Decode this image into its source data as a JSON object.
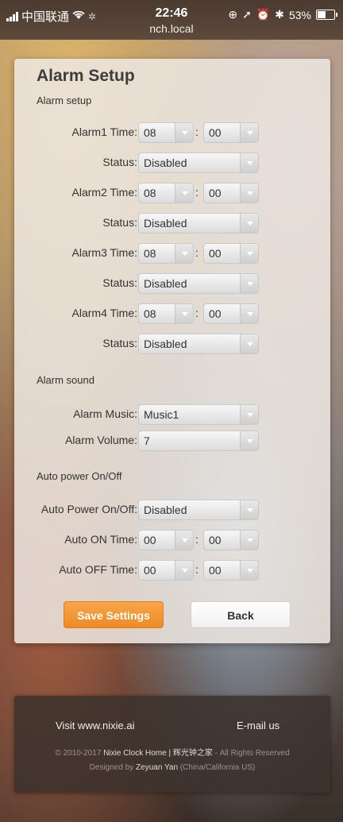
{
  "status_bar": {
    "carrier": "中国联通",
    "time": "22:46",
    "url": "nch.local",
    "battery_percent": 53,
    "battery_label": "53%"
  },
  "page": {
    "title": "Alarm Setup",
    "sections": {
      "alarm_setup": "Alarm setup",
      "alarm_sound": "Alarm sound",
      "auto_power": "Auto power On/Off"
    },
    "alarms": [
      {
        "time_label": "Alarm1 Time:",
        "hour": "08",
        "minute": "00",
        "status_label": "Status:",
        "status": "Disabled"
      },
      {
        "time_label": "Alarm2 Time:",
        "hour": "08",
        "minute": "00",
        "status_label": "Status:",
        "status": "Disabled"
      },
      {
        "time_label": "Alarm3 Time:",
        "hour": "08",
        "minute": "00",
        "status_label": "Status:",
        "status": "Disabled"
      },
      {
        "time_label": "Alarm4 Time:",
        "hour": "08",
        "minute": "00",
        "status_label": "Status:",
        "status": "Disabled"
      }
    ],
    "sound": {
      "music_label": "Alarm Music:",
      "music": "Music1",
      "volume_label": "Alarm Volume:",
      "volume": "7"
    },
    "auto_power": {
      "mode_label": "Auto Power On/Off:",
      "mode": "Disabled",
      "on_label": "Auto ON Time:",
      "on_hour": "00",
      "on_minute": "00",
      "off_label": "Auto OFF Time:",
      "off_hour": "00",
      "off_minute": "00"
    },
    "colon": ":",
    "buttons": {
      "save": "Save Settings",
      "back": "Back"
    }
  },
  "footer": {
    "visit": "Visit www.nixie.ai",
    "email": "E-mail us",
    "copyright_prefix": "© 2010-2017 ",
    "copyright_site": "Nixie Clock Home | 辉光钟之家",
    "copyright_suffix": " - All Rights Reserved",
    "designed_prefix": "Designed by ",
    "designer": "Zeyuan Yan",
    "designed_suffix": " (China/California US)"
  },
  "colors": {
    "accent": "#ee8a25",
    "panel": "#eee8e2",
    "footer": "#3c322c"
  }
}
